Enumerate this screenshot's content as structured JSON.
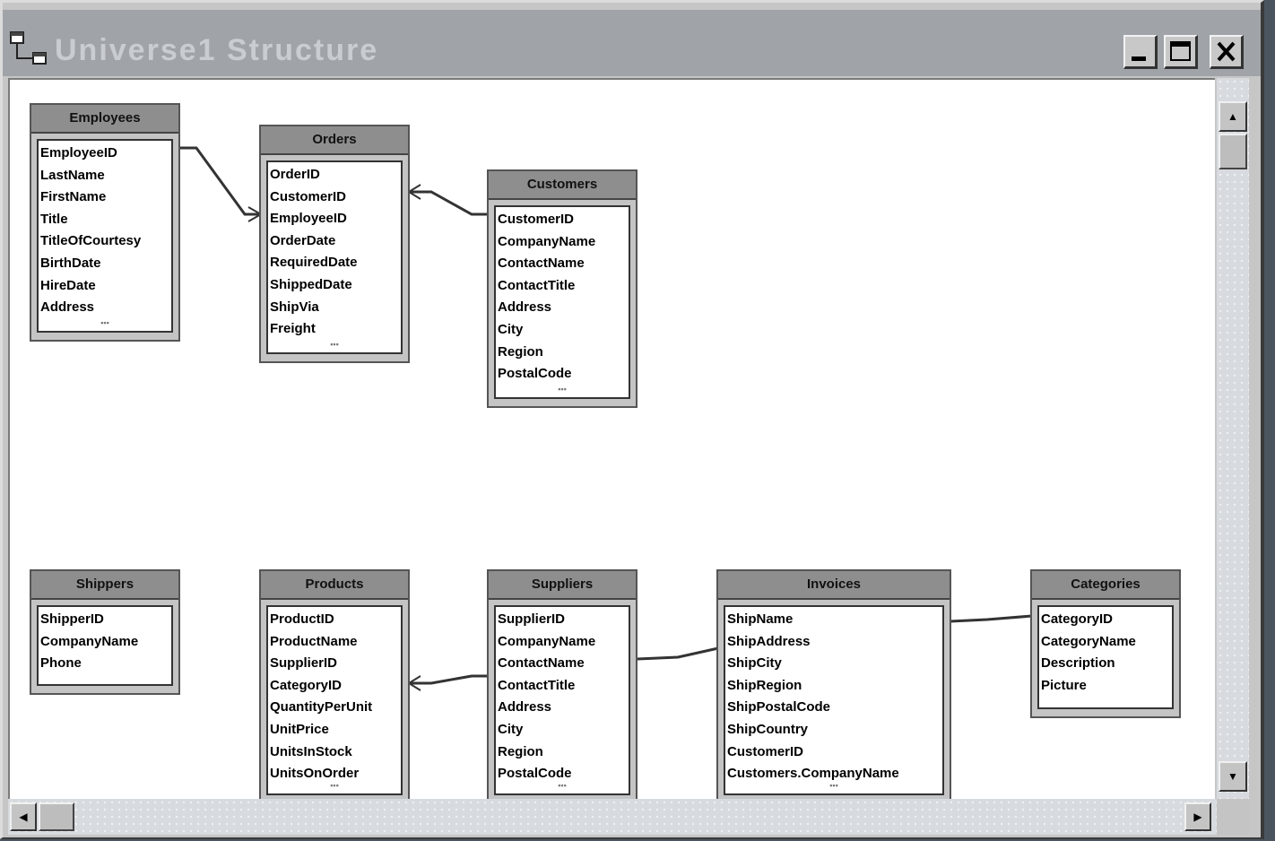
{
  "window": {
    "title": "Universe1 Structure",
    "icons": {
      "app": "universe-structure-icon",
      "minimize": "minimize-icon",
      "maximize": "maximize-icon",
      "close": "close-icon"
    },
    "colors": {
      "titlebar": "#a0a4a8",
      "canvas": "#ffffff",
      "table_header": "#8e8e8e",
      "link": "#333333"
    }
  },
  "tables": [
    {
      "name": "Employees",
      "columns": [
        "EmployeeID",
        "LastName",
        "FirstName",
        "Title",
        "TitleOfCourtesy",
        "BirthDate",
        "HireDate",
        "Address"
      ]
    },
    {
      "name": "Orders",
      "columns": [
        "OrderID",
        "CustomerID",
        "EmployeeID",
        "OrderDate",
        "RequiredDate",
        "ShippedDate",
        "ShipVia",
        "Freight"
      ]
    },
    {
      "name": "Customers",
      "columns": [
        "CustomerID",
        "CompanyName",
        "ContactName",
        "ContactTitle",
        "Address",
        "City",
        "Region",
        "PostalCode"
      ]
    },
    {
      "name": "Shippers",
      "columns": [
        "ShipperID",
        "CompanyName",
        "Phone"
      ]
    },
    {
      "name": "Products",
      "columns": [
        "ProductID",
        "ProductName",
        "SupplierID",
        "CategoryID",
        "QuantityPerUnit",
        "UnitPrice",
        "UnitsInStock",
        "UnitsOnOrder"
      ]
    },
    {
      "name": "Suppliers",
      "columns": [
        "SupplierID",
        "CompanyName",
        "ContactName",
        "ContactTitle",
        "Address",
        "City",
        "Region",
        "PostalCode"
      ]
    },
    {
      "name": "Invoices",
      "columns": [
        "ShipName",
        "ShipAddress",
        "ShipCity",
        "ShipRegion",
        "ShipPostalCode",
        "ShipCountry",
        "CustomerID",
        "Customers.CompanyName"
      ]
    },
    {
      "name": "Categories",
      "columns": [
        "CategoryID",
        "CategoryName",
        "Description",
        "Picture"
      ]
    }
  ],
  "scroll": {
    "up": "▲",
    "down": "▼",
    "left": "◀",
    "right": "▶",
    "icons": {
      "up": "scroll-up-icon",
      "down": "scroll-down-icon",
      "left": "scroll-left-icon",
      "right": "scroll-right-icon"
    }
  }
}
